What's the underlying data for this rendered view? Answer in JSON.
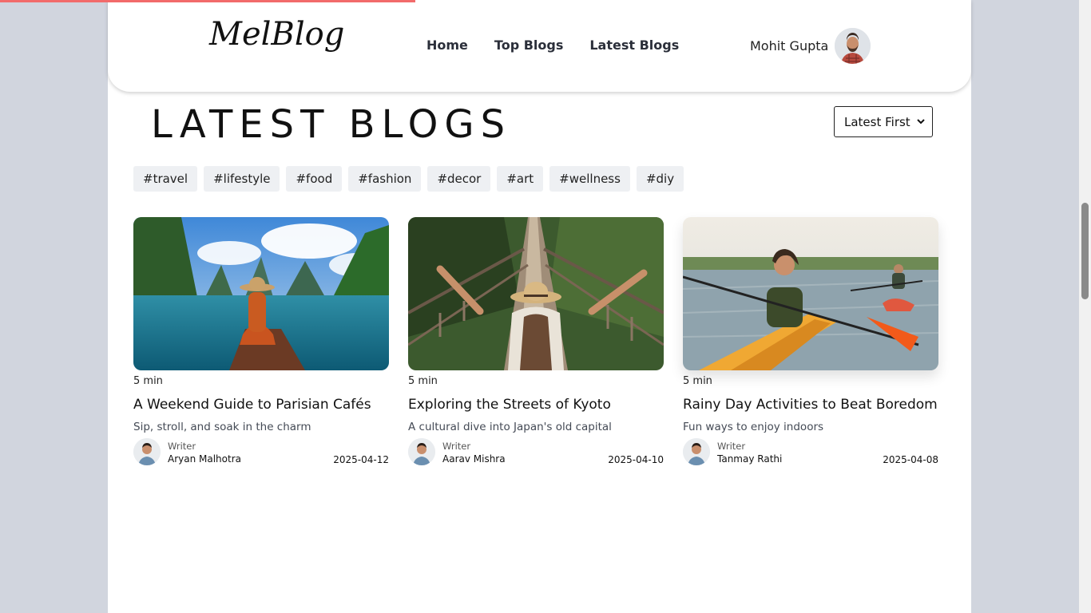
{
  "header": {
    "logo": "MelBlog",
    "nav": [
      "Home",
      "Top Blogs",
      "Latest Blogs"
    ],
    "user_name": "Mohit Gupta"
  },
  "main": {
    "title": "LATEST BLOGS",
    "sort": {
      "selected": "Latest First"
    },
    "tags": [
      "#travel",
      "#lifestyle",
      "#food",
      "#fashion",
      "#decor",
      "#art",
      "#wellness",
      "#diy"
    ],
    "cards": [
      {
        "read_time": "5 min",
        "title": "A Weekend Guide to Parisian Cafés",
        "subtitle": "Sip, stroll, and soak in the charm",
        "author_role": "Writer",
        "author": "Aryan Malhotra",
        "date": "2025-04-12"
      },
      {
        "read_time": "5 min",
        "title": "Exploring the Streets of Kyoto",
        "subtitle": "A cultural dive into Japan's old capital",
        "author_role": "Writer",
        "author": "Aarav Mishra",
        "date": "2025-04-10"
      },
      {
        "read_time": "5 min",
        "title": "Rainy Day Activities to Beat Boredom",
        "subtitle": "Fun ways to enjoy indoors",
        "author_role": "Writer",
        "author": "Tanmay Rathi",
        "date": "2025-04-08"
      }
    ]
  },
  "colors": {
    "progress": "#f26b6b",
    "page_bg": "#d1d5de",
    "tag_bg": "#eef0f3"
  }
}
